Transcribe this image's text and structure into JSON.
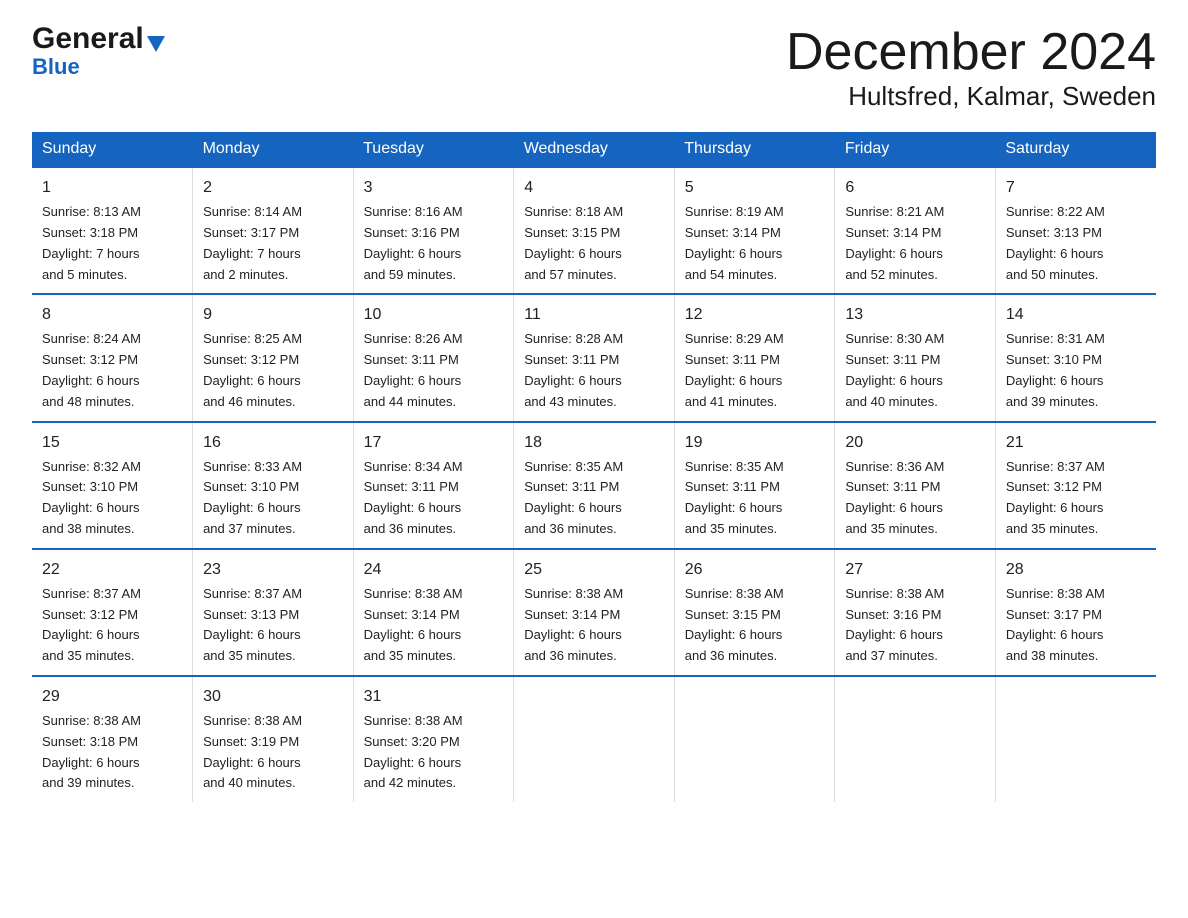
{
  "logo": {
    "general": "General",
    "triangle": "▼",
    "blue": "Blue"
  },
  "title": "December 2024",
  "location": "Hultsfred, Kalmar, Sweden",
  "days_of_week": [
    "Sunday",
    "Monday",
    "Tuesday",
    "Wednesday",
    "Thursday",
    "Friday",
    "Saturday"
  ],
  "weeks": [
    [
      {
        "day": "1",
        "sunrise": "8:13 AM",
        "sunset": "3:18 PM",
        "daylight": "7 hours and 5 minutes."
      },
      {
        "day": "2",
        "sunrise": "8:14 AM",
        "sunset": "3:17 PM",
        "daylight": "7 hours and 2 minutes."
      },
      {
        "day": "3",
        "sunrise": "8:16 AM",
        "sunset": "3:16 PM",
        "daylight": "6 hours and 59 minutes."
      },
      {
        "day": "4",
        "sunrise": "8:18 AM",
        "sunset": "3:15 PM",
        "daylight": "6 hours and 57 minutes."
      },
      {
        "day": "5",
        "sunrise": "8:19 AM",
        "sunset": "3:14 PM",
        "daylight": "6 hours and 54 minutes."
      },
      {
        "day": "6",
        "sunrise": "8:21 AM",
        "sunset": "3:14 PM",
        "daylight": "6 hours and 52 minutes."
      },
      {
        "day": "7",
        "sunrise": "8:22 AM",
        "sunset": "3:13 PM",
        "daylight": "6 hours and 50 minutes."
      }
    ],
    [
      {
        "day": "8",
        "sunrise": "8:24 AM",
        "sunset": "3:12 PM",
        "daylight": "6 hours and 48 minutes."
      },
      {
        "day": "9",
        "sunrise": "8:25 AM",
        "sunset": "3:12 PM",
        "daylight": "6 hours and 46 minutes."
      },
      {
        "day": "10",
        "sunrise": "8:26 AM",
        "sunset": "3:11 PM",
        "daylight": "6 hours and 44 minutes."
      },
      {
        "day": "11",
        "sunrise": "8:28 AM",
        "sunset": "3:11 PM",
        "daylight": "6 hours and 43 minutes."
      },
      {
        "day": "12",
        "sunrise": "8:29 AM",
        "sunset": "3:11 PM",
        "daylight": "6 hours and 41 minutes."
      },
      {
        "day": "13",
        "sunrise": "8:30 AM",
        "sunset": "3:11 PM",
        "daylight": "6 hours and 40 minutes."
      },
      {
        "day": "14",
        "sunrise": "8:31 AM",
        "sunset": "3:10 PM",
        "daylight": "6 hours and 39 minutes."
      }
    ],
    [
      {
        "day": "15",
        "sunrise": "8:32 AM",
        "sunset": "3:10 PM",
        "daylight": "6 hours and 38 minutes."
      },
      {
        "day": "16",
        "sunrise": "8:33 AM",
        "sunset": "3:10 PM",
        "daylight": "6 hours and 37 minutes."
      },
      {
        "day": "17",
        "sunrise": "8:34 AM",
        "sunset": "3:11 PM",
        "daylight": "6 hours and 36 minutes."
      },
      {
        "day": "18",
        "sunrise": "8:35 AM",
        "sunset": "3:11 PM",
        "daylight": "6 hours and 36 minutes."
      },
      {
        "day": "19",
        "sunrise": "8:35 AM",
        "sunset": "3:11 PM",
        "daylight": "6 hours and 35 minutes."
      },
      {
        "day": "20",
        "sunrise": "8:36 AM",
        "sunset": "3:11 PM",
        "daylight": "6 hours and 35 minutes."
      },
      {
        "day": "21",
        "sunrise": "8:37 AM",
        "sunset": "3:12 PM",
        "daylight": "6 hours and 35 minutes."
      }
    ],
    [
      {
        "day": "22",
        "sunrise": "8:37 AM",
        "sunset": "3:12 PM",
        "daylight": "6 hours and 35 minutes."
      },
      {
        "day": "23",
        "sunrise": "8:37 AM",
        "sunset": "3:13 PM",
        "daylight": "6 hours and 35 minutes."
      },
      {
        "day": "24",
        "sunrise": "8:38 AM",
        "sunset": "3:14 PM",
        "daylight": "6 hours and 35 minutes."
      },
      {
        "day": "25",
        "sunrise": "8:38 AM",
        "sunset": "3:14 PM",
        "daylight": "6 hours and 36 minutes."
      },
      {
        "day": "26",
        "sunrise": "8:38 AM",
        "sunset": "3:15 PM",
        "daylight": "6 hours and 36 minutes."
      },
      {
        "day": "27",
        "sunrise": "8:38 AM",
        "sunset": "3:16 PM",
        "daylight": "6 hours and 37 minutes."
      },
      {
        "day": "28",
        "sunrise": "8:38 AM",
        "sunset": "3:17 PM",
        "daylight": "6 hours and 38 minutes."
      }
    ],
    [
      {
        "day": "29",
        "sunrise": "8:38 AM",
        "sunset": "3:18 PM",
        "daylight": "6 hours and 39 minutes."
      },
      {
        "day": "30",
        "sunrise": "8:38 AM",
        "sunset": "3:19 PM",
        "daylight": "6 hours and 40 minutes."
      },
      {
        "day": "31",
        "sunrise": "8:38 AM",
        "sunset": "3:20 PM",
        "daylight": "6 hours and 42 minutes."
      },
      {
        "day": "",
        "sunrise": "",
        "sunset": "",
        "daylight": ""
      },
      {
        "day": "",
        "sunrise": "",
        "sunset": "",
        "daylight": ""
      },
      {
        "day": "",
        "sunrise": "",
        "sunset": "",
        "daylight": ""
      },
      {
        "day": "",
        "sunrise": "",
        "sunset": "",
        "daylight": ""
      }
    ]
  ],
  "labels": {
    "sunrise": "Sunrise:",
    "sunset": "Sunset:",
    "daylight": "Daylight:"
  }
}
